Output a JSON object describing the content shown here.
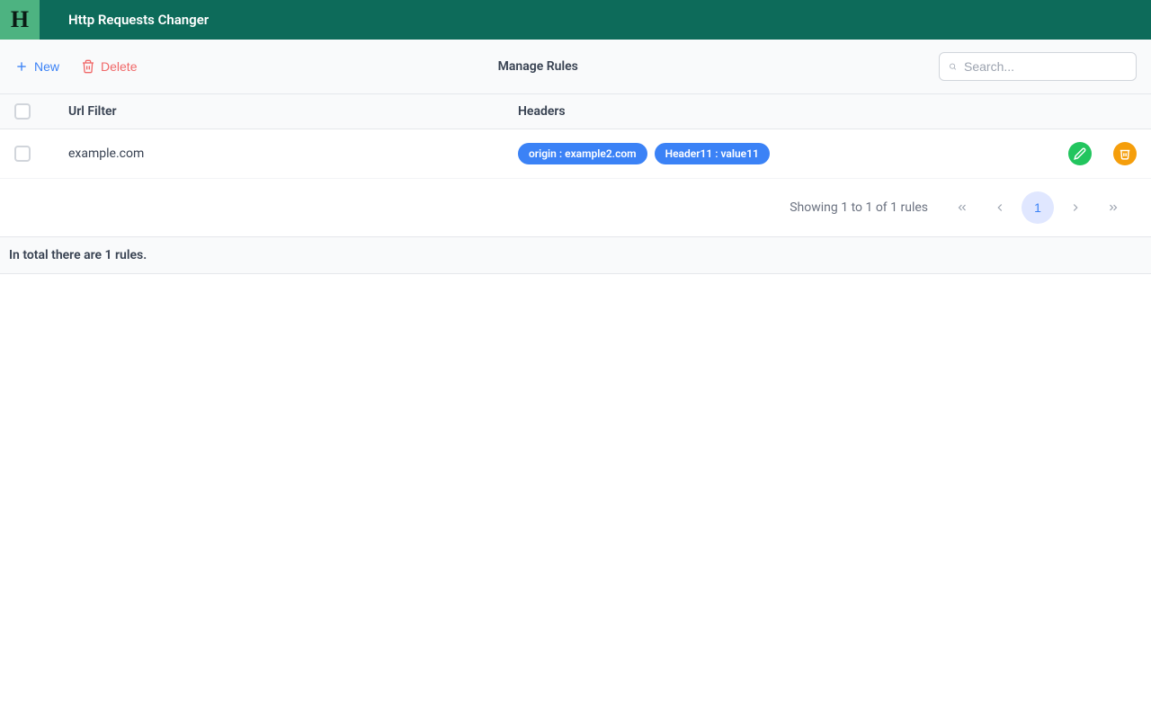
{
  "header": {
    "logo_letter": "H",
    "app_title": "Http Requests Changer"
  },
  "toolbar": {
    "new_label": "New",
    "delete_label": "Delete",
    "page_title": "Manage Rules",
    "search_placeholder": "Search..."
  },
  "table": {
    "col_url_header": "Url Filter",
    "col_headers_header": "Headers",
    "rows": [
      {
        "url": "example.com",
        "headers": [
          "origin : example2.com",
          "Header11 : value11"
        ]
      }
    ]
  },
  "pagination": {
    "summary": "Showing 1 to 1 of 1 rules",
    "current_page": "1"
  },
  "footer": {
    "total_text": "In total there are 1 rules."
  }
}
